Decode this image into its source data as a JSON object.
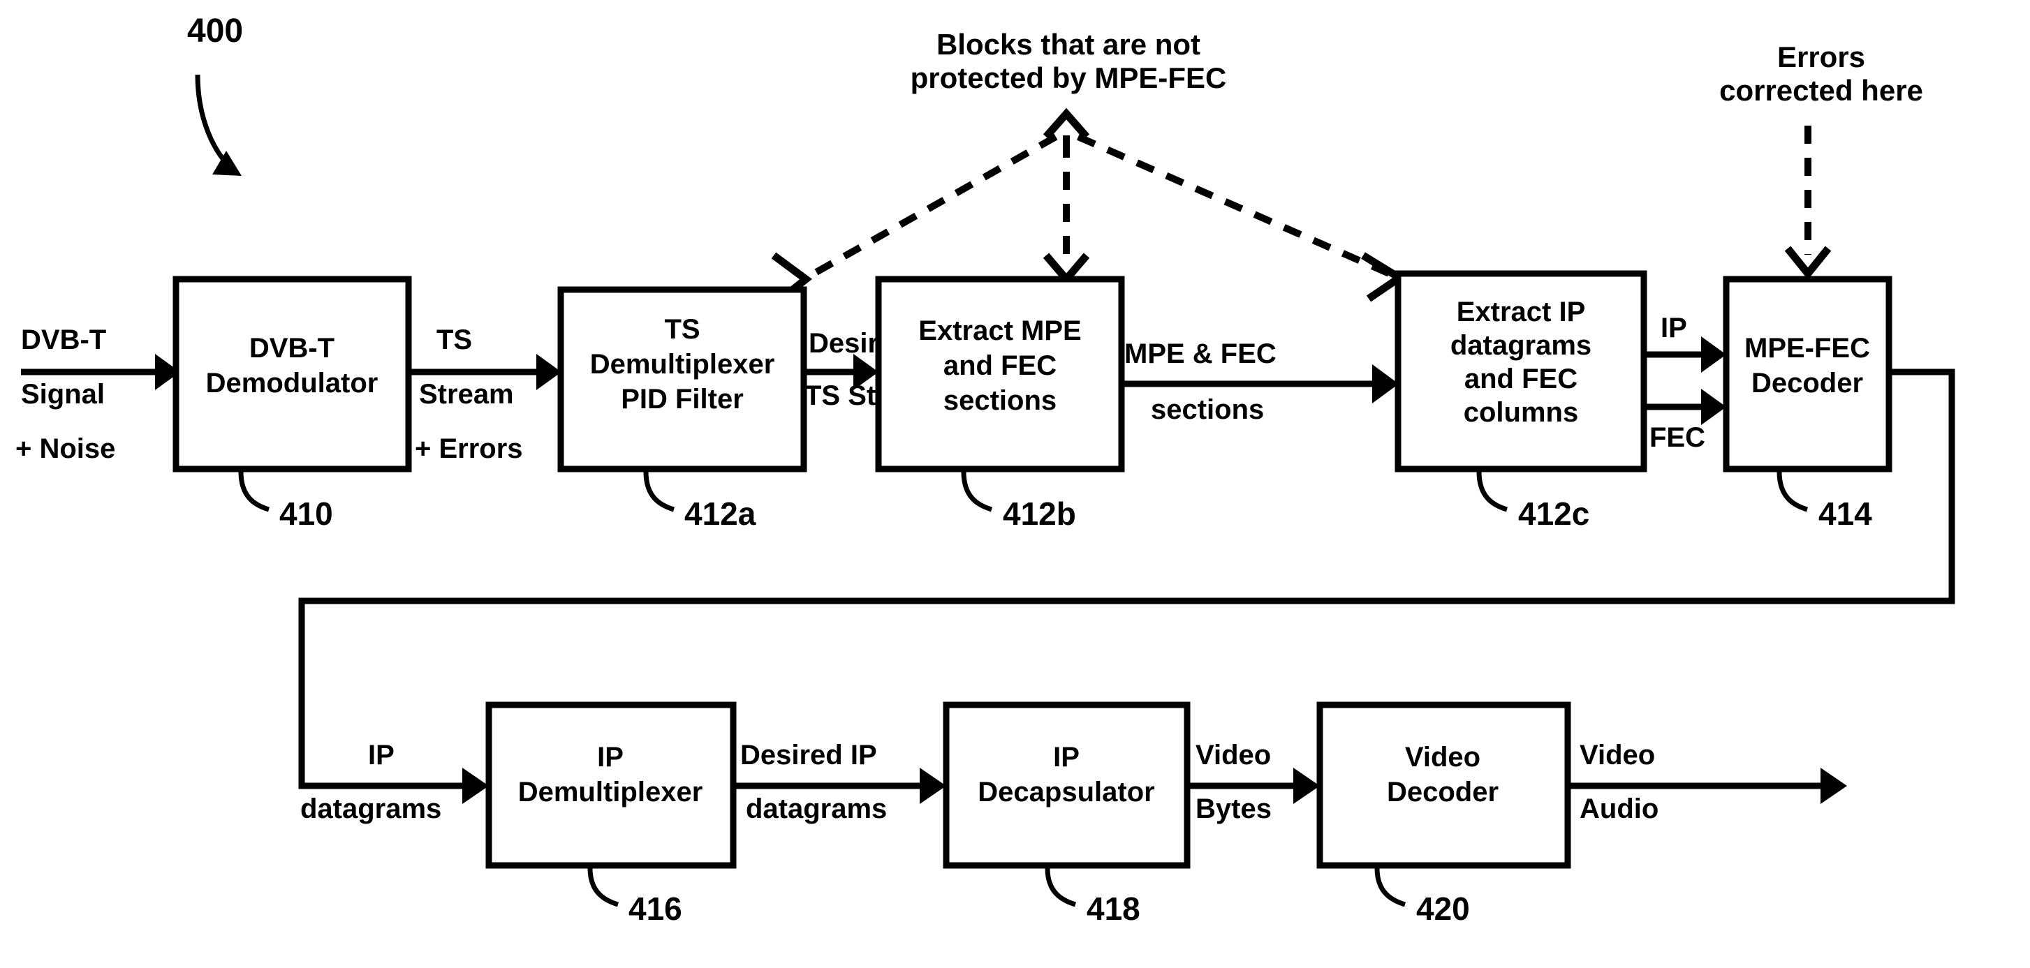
{
  "figure": {
    "number": "400",
    "title_note_left": "Blocks that are not protected by MPE-FEC",
    "title_note_right": "Errors corrected here"
  },
  "notes": {
    "not_protected": {
      "line1": "Blocks that are not",
      "line2": "protected by MPE-FEC"
    },
    "errors_corrected": {
      "line1": "Errors",
      "line2": "corrected here"
    }
  },
  "blocks": [
    {
      "id": "410",
      "ref": "410",
      "lines": [
        "DVB-T",
        "Demodulator"
      ]
    },
    {
      "id": "412a",
      "ref": "412a",
      "lines": [
        "TS",
        "Demultiplexer",
        "PID Filter"
      ]
    },
    {
      "id": "412b",
      "ref": "412b",
      "lines": [
        "Extract MPE",
        "and FEC",
        "sections"
      ]
    },
    {
      "id": "412c",
      "ref": "412c",
      "lines": [
        "Extract IP",
        "datagrams",
        "and FEC",
        "columns"
      ]
    },
    {
      "id": "414",
      "ref": "414",
      "lines": [
        "MPE-FEC",
        "Decoder"
      ]
    },
    {
      "id": "416",
      "ref": "416",
      "lines": [
        "IP",
        "Demultiplexer"
      ]
    },
    {
      "id": "418",
      "ref": "418",
      "lines": [
        "IP",
        "Decapsulator"
      ]
    },
    {
      "id": "420",
      "ref": "420",
      "lines": [
        "Video",
        "Decoder"
      ]
    }
  ],
  "edges": [
    {
      "id": "in-dvbt",
      "lines": [
        "DVB-T",
        "Signal",
        "+ Noise"
      ]
    },
    {
      "id": "ts-stream",
      "lines": [
        "TS",
        "Stream",
        "+ Errors"
      ]
    },
    {
      "id": "desired-ts",
      "lines": [
        "Desired",
        "TS Stream"
      ]
    },
    {
      "id": "mpe-fec-sec",
      "lines": [
        "MPE & FEC",
        "sections"
      ]
    },
    {
      "id": "ip-to-dec",
      "lines": [
        "IP"
      ]
    },
    {
      "id": "fec-to-dec",
      "lines": [
        "FEC"
      ]
    },
    {
      "id": "ip-datagrams",
      "lines": [
        "IP",
        "datagrams"
      ]
    },
    {
      "id": "desired-ip",
      "lines": [
        "Desired IP",
        "datagrams"
      ]
    },
    {
      "id": "video-bytes",
      "lines": [
        "Video",
        "Bytes"
      ]
    },
    {
      "id": "video-audio",
      "lines": [
        "Video",
        "Audio"
      ]
    }
  ],
  "block_labels": {
    "b410_l1": "DVB-T",
    "b410_l2": "Demodulator",
    "b412a_l1": "TS",
    "b412a_l2": "Demultiplexer",
    "b412a_l3": "PID Filter",
    "b412b_l1": "Extract MPE",
    "b412b_l2": "and FEC",
    "b412b_l3": "sections",
    "b412c_l1": "Extract IP",
    "b412c_l2": "datagrams",
    "b412c_l3": "and FEC",
    "b412c_l4": "columns",
    "b414_l1": "MPE-FEC",
    "b414_l2": "Decoder",
    "b416_l1": "IP",
    "b416_l2": "Demultiplexer",
    "b418_l1": "IP",
    "b418_l2": "Decapsulator",
    "b420_l1": "Video",
    "b420_l2": "Decoder"
  },
  "refs": {
    "r410": "410",
    "r412a": "412a",
    "r412b": "412b",
    "r412c": "412c",
    "r414": "414",
    "r416": "416",
    "r418": "418",
    "r420": "420",
    "fig": "400"
  },
  "edge_labels": {
    "in1": "DVB-T",
    "in2": "Signal",
    "in3": "+ Noise",
    "ts1": "TS",
    "ts2": "Stream",
    "ts3": "+ Errors",
    "des1": "Desired",
    "des2": "TS Stream",
    "mfs1": "MPE & FEC",
    "mfs2": "sections",
    "ip_top": "IP",
    "fec_top": "FEC",
    "ipd1": "IP",
    "ipd2": "datagrams",
    "dip1": "Desired IP",
    "dip2": "datagrams",
    "vb1": "Video",
    "vb2": "Bytes",
    "va1": "Video",
    "va2": "Audio"
  },
  "note_labels": {
    "np1": "Blocks that are not",
    "np2": "protected by MPE-FEC",
    "ec1": "Errors",
    "ec2": "corrected here"
  },
  "colors": {
    "stroke": "#000000",
    "fill": "#ffffff",
    "background": "#ffffff"
  }
}
